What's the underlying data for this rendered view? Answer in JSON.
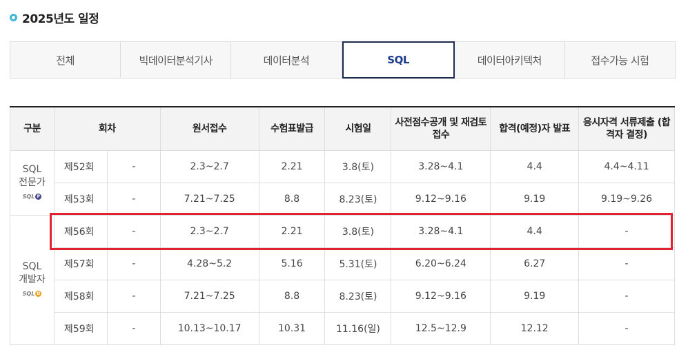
{
  "page": {
    "title": "2025년도 일정"
  },
  "tabs": [
    {
      "label": "전체"
    },
    {
      "label": "빅데이터분석기사"
    },
    {
      "label": "데이터분석"
    },
    {
      "label": "SQL"
    },
    {
      "label": "데이터아키텍처"
    },
    {
      "label": "접수가능 시험"
    }
  ],
  "active_tab": "SQL",
  "colors": {
    "accent": "#3fb7d8",
    "active_tab_border": "#1c2a4d",
    "highlight": "#e0232e",
    "logo_sqlp": "#4a4a8a",
    "logo_sqld": "#f0a020"
  },
  "table": {
    "headers": [
      "구분",
      "회차",
      "원서접수",
      "수험표발급",
      "시험일",
      "사전점수공개 및 재검토 접수",
      "합격(예정)자 발표",
      "응시자격 서류제출 (합격자 결정)"
    ],
    "groups": [
      {
        "label": "SQL\n전문가",
        "logo": "SQL",
        "logo_badge": "P",
        "rows": [
          [
            "제52회",
            "-",
            "2.3~2.7",
            "2.21",
            "3.8(토)",
            "3.28~4.1",
            "4.4",
            "4.4~4.11"
          ],
          [
            "제53회",
            "-",
            "7.21~7.25",
            "8.8",
            "8.23(토)",
            "9.12~9.16",
            "9.19",
            "9.19~9.26"
          ]
        ]
      },
      {
        "label": "SQL\n개발자",
        "logo": "SQL",
        "logo_badge": "D",
        "rows": [
          [
            "제56회",
            "-",
            "2.3~2.7",
            "2.21",
            "3.8(토)",
            "3.28~4.1",
            "4.4",
            "-"
          ],
          [
            "제57회",
            "-",
            "4.28~5.2",
            "5.16",
            "5.31(토)",
            "6.20~6.24",
            "6.27",
            "-"
          ],
          [
            "제58회",
            "-",
            "7.21~7.25",
            "8.8",
            "8.23(토)",
            "9.12~9.16",
            "9.19",
            "-"
          ],
          [
            "제59회",
            "-",
            "10.13~10.17",
            "10.31",
            "11.16(일)",
            "12.5~12.9",
            "12.12",
            "-"
          ]
        ]
      }
    ]
  }
}
